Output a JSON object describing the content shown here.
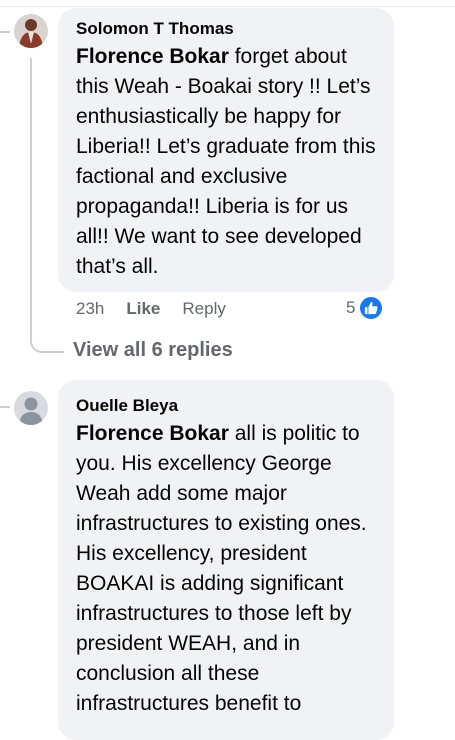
{
  "comments": [
    {
      "author": "Solomon T Thomas",
      "mention": "Florence Bokar",
      "body": " forget about this Weah - Boakai story !! Let’s enthusiastically be happy for Liberia!! Let’s graduate from this factional and exclusive propaganda!! Liberia is for us all!! We want to see developed that’s all.",
      "time": "23h",
      "like_label": "Like",
      "reply_label": "Reply",
      "reaction_count": "5",
      "view_replies": "View all 6 replies"
    },
    {
      "author": "Ouelle Bleya",
      "mention": "Florence Bokar",
      "body": " all is politic to you. His excellency George Weah add some major infrastructures to existing ones. His excellency, president BOAKAI is adding significant infrastructures to those left by president WEAH, and in conclusion all these infrastructures benefit to"
    }
  ],
  "colors": {
    "bubble": "#f0f2f5",
    "meta": "#65676b",
    "like_blue": "#1877f2",
    "thread_line": "#ccd0d5"
  }
}
